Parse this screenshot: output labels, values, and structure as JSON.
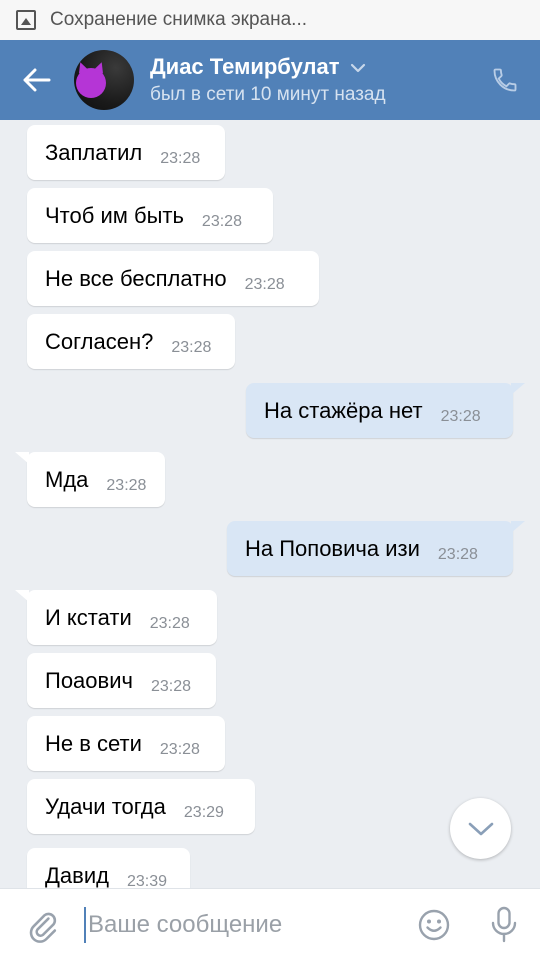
{
  "status_bar": {
    "notification_text": "Сохранение снимка экрана..."
  },
  "header": {
    "contact_name": "Диас Темирбулат",
    "contact_status": "был в сети 10 минут назад",
    "accent_color": "#5181b8"
  },
  "messages": [
    {
      "text": "Заплатил",
      "time": "23:28",
      "direction": "in"
    },
    {
      "text": "Чтоб им быть",
      "time": "23:28",
      "direction": "in"
    },
    {
      "text": "Не все бесплатно",
      "time": "23:28",
      "direction": "in"
    },
    {
      "text": "Согласен?",
      "time": "23:28",
      "direction": "in"
    },
    {
      "text": "На стажёра нет",
      "time": "23:28",
      "direction": "out"
    },
    {
      "text": "Мда",
      "time": "23:28",
      "direction": "in"
    },
    {
      "text": "На Поповича изи",
      "time": "23:28",
      "direction": "out"
    },
    {
      "text": "И кстати",
      "time": "23:28",
      "direction": "in"
    },
    {
      "text": "Поаович",
      "time": "23:28",
      "direction": "in"
    },
    {
      "text": "Не в сети",
      "time": "23:28",
      "direction": "in"
    },
    {
      "text": "Удачи тогда",
      "time": "23:29",
      "direction": "in"
    },
    {
      "text": "Давид",
      "time": "23:39",
      "direction": "in"
    }
  ],
  "composer": {
    "placeholder": "Ваше сообщение",
    "value": ""
  },
  "icons": {
    "back": "arrow-left-icon",
    "dropdown": "chevron-down-icon",
    "call": "phone-icon",
    "scroll_down": "chevron-down-icon",
    "attach": "paperclip-icon",
    "emoji": "smile-icon",
    "mic": "microphone-icon"
  }
}
